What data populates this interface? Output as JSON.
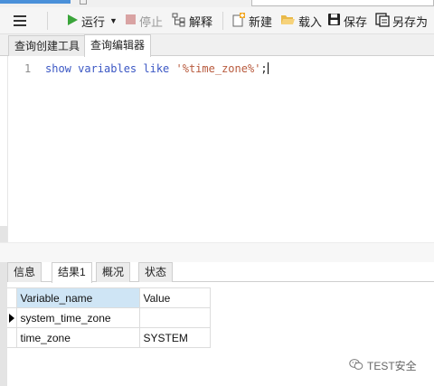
{
  "toolbar": {
    "run_label": "运行",
    "stop_label": "停止",
    "explain_label": "解释",
    "new_label": "新建",
    "load_label": "载入",
    "save_label": "保存",
    "save_as_label": "另存为"
  },
  "query_tabs": {
    "builder": "查询创建工具",
    "editor": "查询编辑器"
  },
  "editor": {
    "line_number": "1",
    "code_keywords": "show variables like ",
    "code_string": "'%time_zone%'",
    "code_end": ";"
  },
  "result_tabs": {
    "info": "信息",
    "result1": "结果1",
    "profile": "概况",
    "status": "状态"
  },
  "result_table": {
    "columns": [
      "Variable_name",
      "Value"
    ],
    "rows": [
      [
        "system_time_zone",
        ""
      ],
      [
        "time_zone",
        "SYSTEM"
      ]
    ]
  },
  "watermark": {
    "text": "TEST安全",
    "logo_icon": "wechat-logo"
  },
  "icons": {
    "menu": "hamburger-icon",
    "run": "play-icon",
    "stop": "stop-icon",
    "explain": "explain-icon",
    "new": "new-query-icon",
    "load": "folder-open-icon",
    "save": "save-icon",
    "save_as": "save-as-icon"
  },
  "colors": {
    "keyword": "#3b57c4",
    "string": "#b85a3d",
    "run_green": "#3aa43a",
    "header_highlight": "#cfe5f5"
  }
}
